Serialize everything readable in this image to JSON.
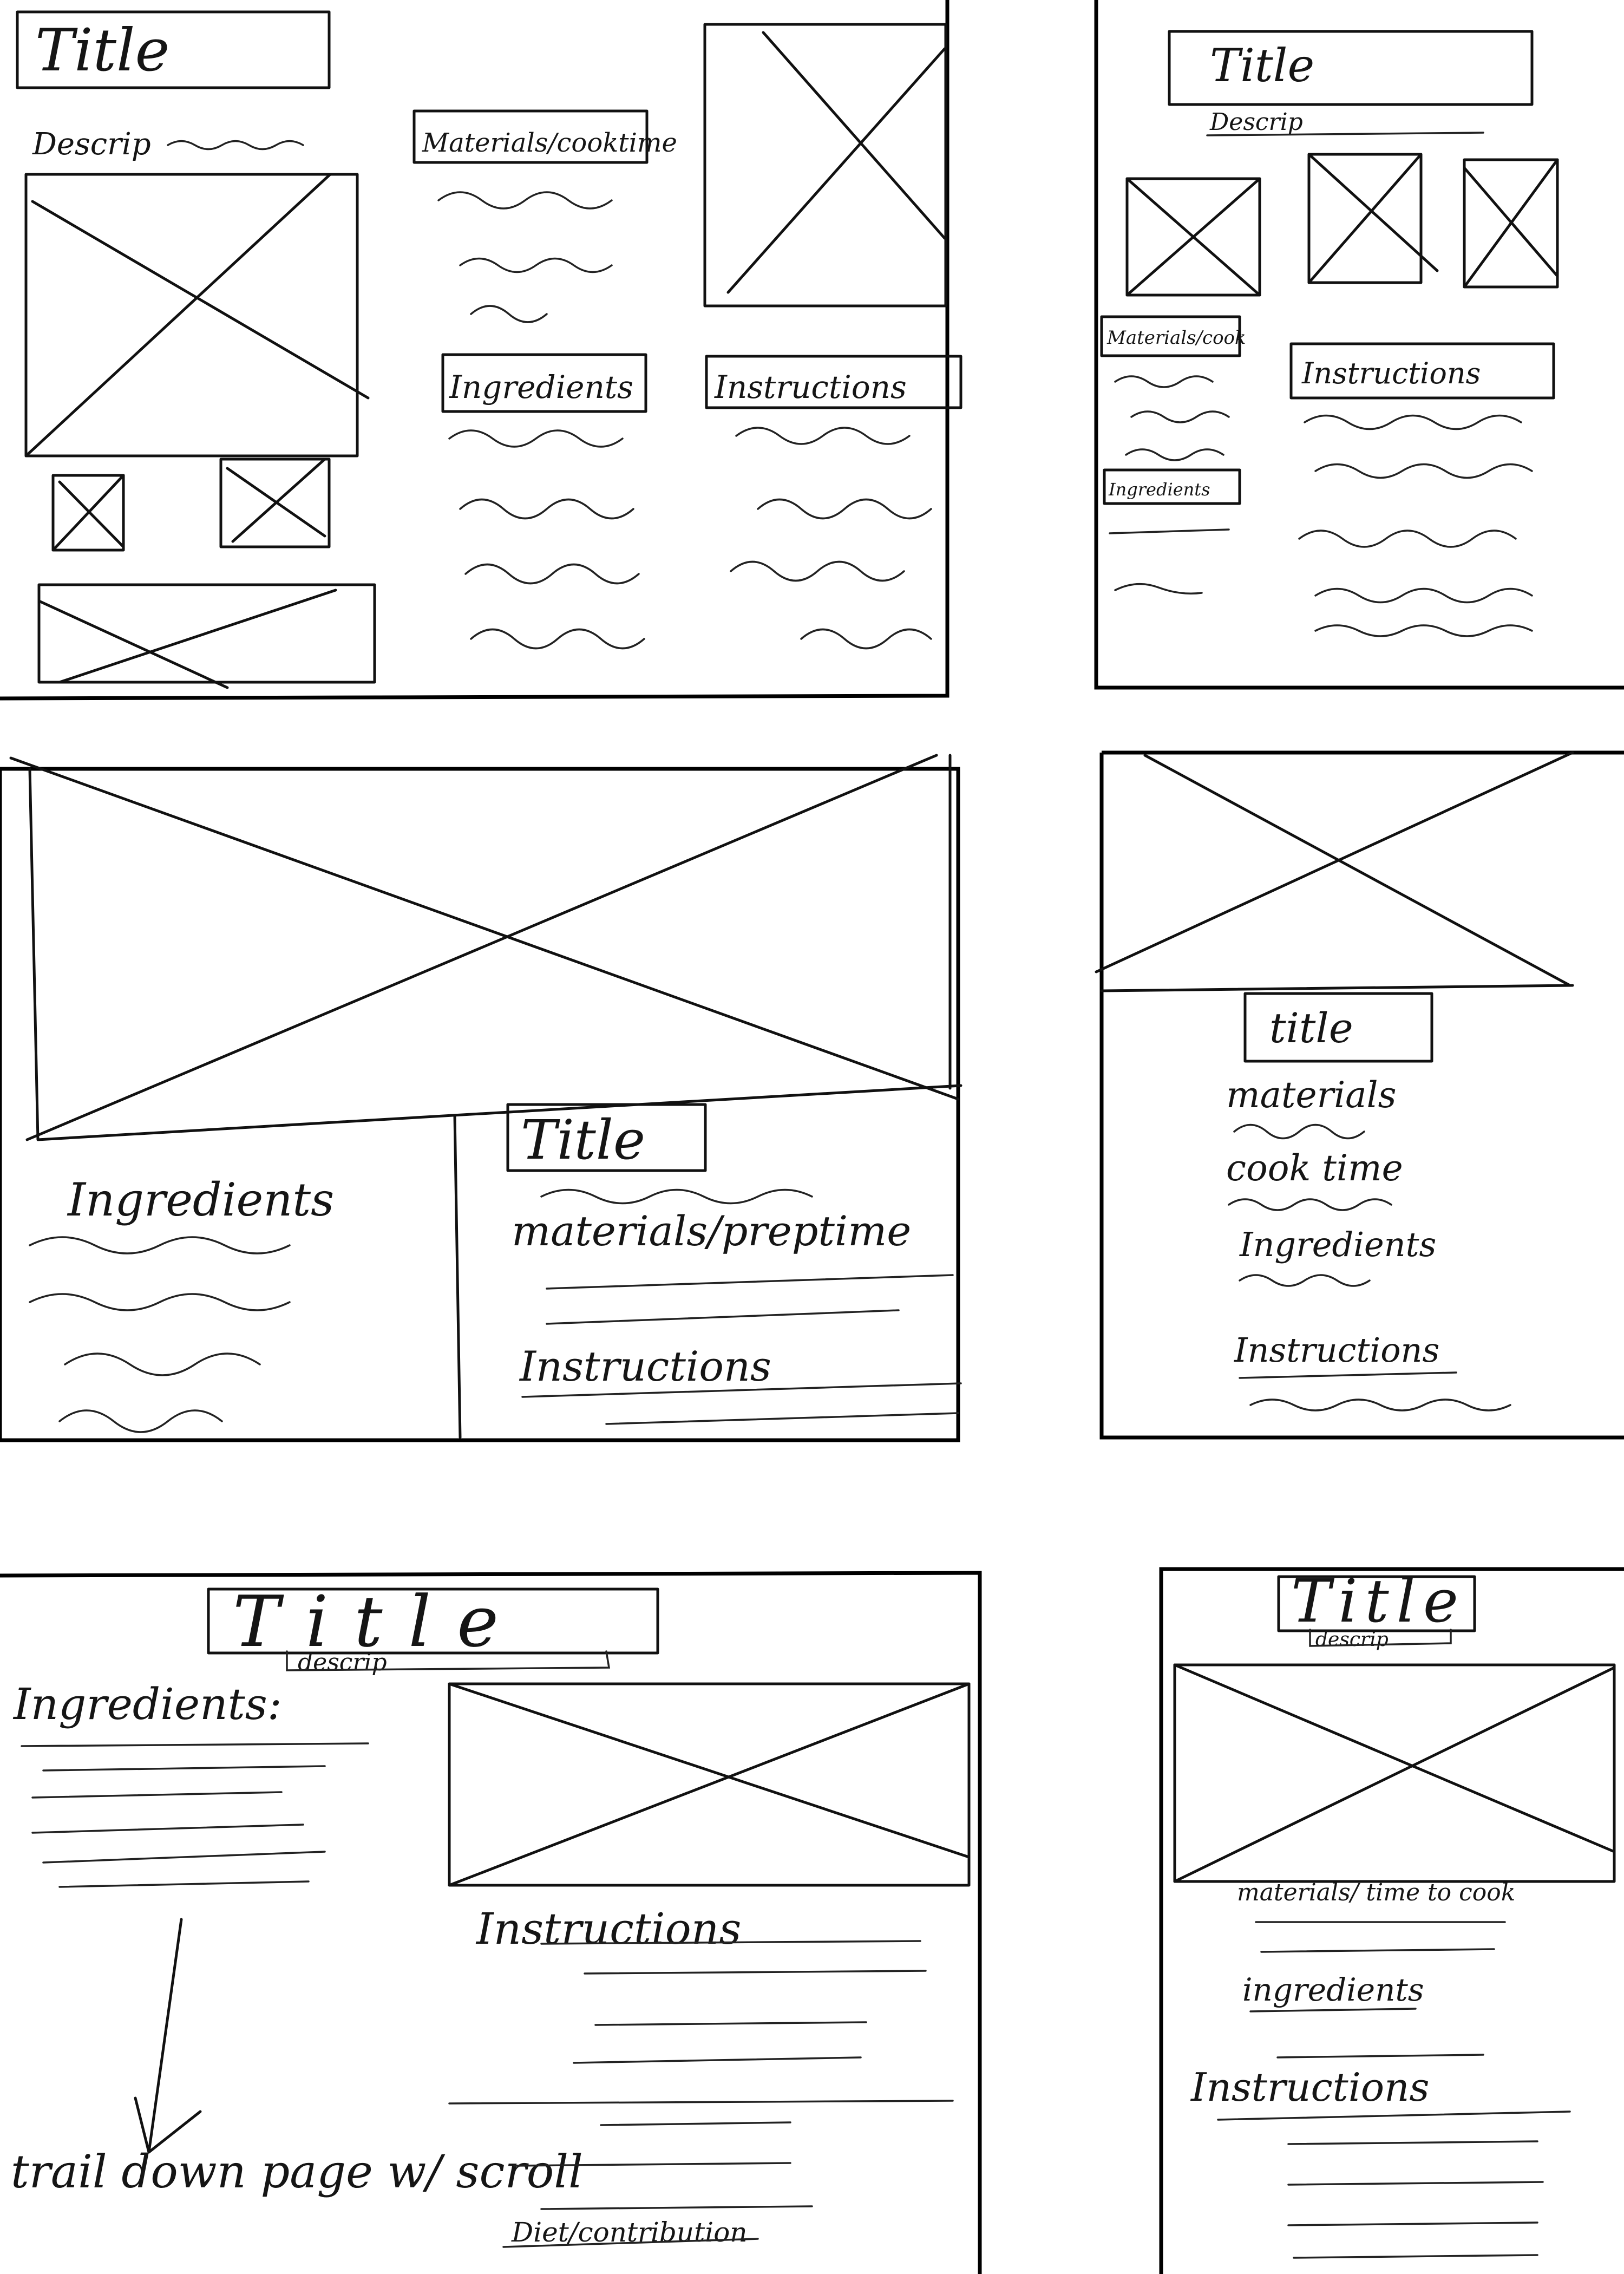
{
  "panels": {
    "p1": {
      "title": "Title",
      "description": "Descrip",
      "materials": "Materials/cooktime",
      "ingredients": "Ingredients",
      "instructions": "Instructions"
    },
    "p2": {
      "title": "Title",
      "description": "Descrip",
      "materials": "Materials/cook",
      "ingredients": "Ingredients",
      "instructions": "Instructions"
    },
    "p3": {
      "ingredients": "Ingredients",
      "title": "Title",
      "materials": "materials/preptime",
      "instructions": "Instructions"
    },
    "p4": {
      "title": "title",
      "materials": "materials",
      "cook_time": "cook time",
      "ingredients": "Ingredients",
      "instructions": "Instructions"
    },
    "p5": {
      "title": "Title",
      "description": "descrip",
      "ingredients": "Ingredients:",
      "instructions": "Instructions",
      "scroll_note": "trail down page w/ scroll",
      "footer": "Diet/contribution"
    },
    "p6": {
      "title": "Title",
      "description": "descrip",
      "materials": "materials/ time to cook",
      "ingredients": "ingredients",
      "instructions": "Instructions"
    }
  },
  "colors": {
    "ink": "#111111",
    "paper": "#ffffff"
  }
}
